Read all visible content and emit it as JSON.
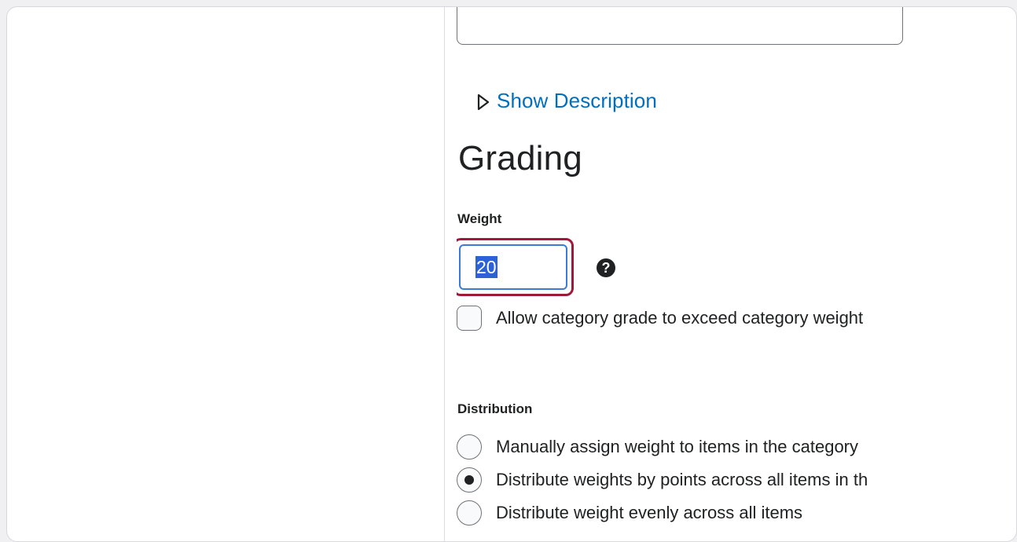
{
  "show_description": {
    "label": "Show Description",
    "icon": "triangle-right-icon",
    "link_color": "#006fbf"
  },
  "grading": {
    "heading": "Grading",
    "weight": {
      "label": "Weight",
      "value": "20",
      "help_icon": "question-circle-icon",
      "help_glyph": "?",
      "focus_color": "#a0193a"
    },
    "exceed_checkbox": {
      "label": "Allow category grade to exceed category weight",
      "checked": false
    },
    "distribution": {
      "label": "Distribution",
      "options": [
        {
          "label": "Manually assign weight to items in the category",
          "checked": false
        },
        {
          "label": "Distribute weights by points across all items in th",
          "checked": true
        },
        {
          "label": "Distribute weight evenly across all items",
          "checked": false
        }
      ]
    }
  }
}
